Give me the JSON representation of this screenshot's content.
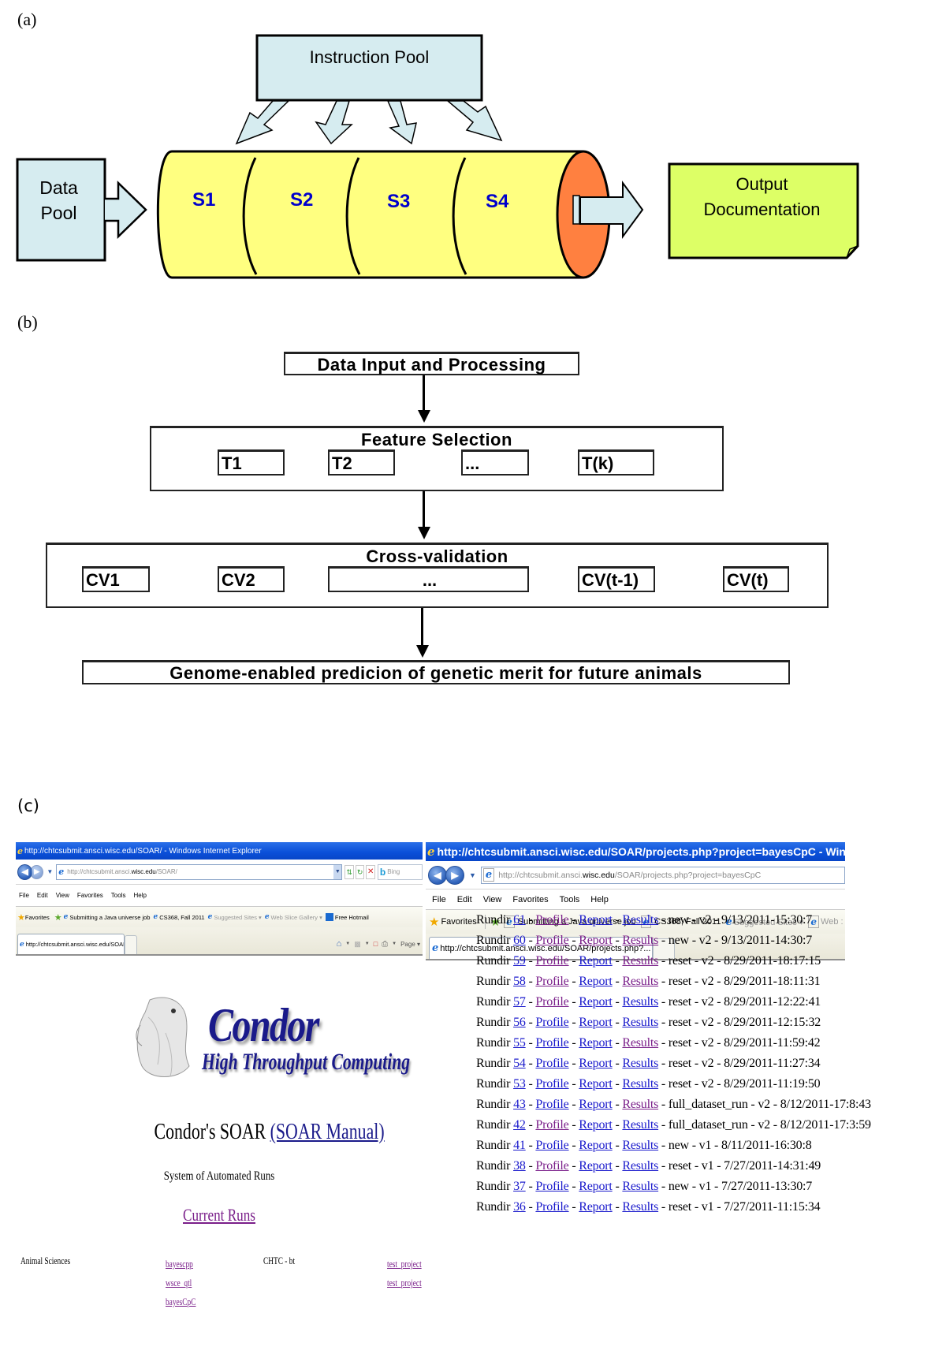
{
  "panel_a": {
    "label": "(a)",
    "instruction_pool": "Instruction Pool",
    "data_pool": [
      "Data",
      "Pool"
    ],
    "stages": [
      "S1",
      "S2",
      "S3",
      "S4"
    ],
    "output": [
      "Output",
      "Documentation"
    ],
    "colors": {
      "pool_fill": "#d6ecf0",
      "cylinder_fill": "#ffff80",
      "cylinder_end": "#ff8040",
      "output_fill": "#ddff66",
      "stage_text": "#0000cc"
    }
  },
  "panel_b": {
    "label": "(b)",
    "step1": "Data Input and Processing",
    "step2_title": "Feature Selection",
    "step2_items": [
      "T1",
      "T2",
      "...",
      "T(k)"
    ],
    "step3_title": "Cross-validation",
    "step3_items": [
      "CV1",
      "CV2",
      "...",
      "CV(t-1)",
      "CV(t)"
    ],
    "step4": "Genome-enabled predicion of genetic merit for future animals"
  },
  "panel_c": {
    "label": "(c)",
    "left_window": {
      "title": "http://chtcsubmit.ansci.wisc.edu/SOAR/ - Windows Internet Explorer",
      "address_prefix": "http://chtcsubmit.ansci.",
      "address_domain": "wisc.edu",
      "address_suffix": "/SOAR/",
      "search_placeholder": "Bing",
      "menu": [
        "File",
        "Edit",
        "View",
        "Favorites",
        "Tools",
        "Help"
      ],
      "favorites_label": "Favorites",
      "favorites": [
        "Submitting a Java universe job",
        "CS368, Fall 2011",
        "Suggested Sites ▾",
        "Web Slice Gallery ▾",
        "Free Hotmail"
      ],
      "tab_title": "http://chtcsubmit.ansci.wisc.edu/SOAR/",
      "page_menu": "Page ▾",
      "logo_word": "Condor",
      "logo_sub": "High Throughput Computing",
      "heading": "Condor's SOAR",
      "heading_link": "(SOAR Manual)",
      "subtitle": "System of Automated Runs",
      "current_runs": "Current Runs",
      "group1": "Animal Sciences",
      "group1_projects": [
        "bayescpp",
        "wsce_qtl",
        "bayesCpC"
      ],
      "group2": "CHTC - bt",
      "group2_projects": [
        "test_project",
        "test_project"
      ]
    },
    "right_window": {
      "title": "http://chtcsubmit.ansci.wisc.edu/SOAR/projects.php?project=bayesCpC - Windows Inte",
      "address_prefix": "http://chtcsubmit.ansci.",
      "address_domain": "wisc.edu",
      "address_suffix": "/SOAR/projects.php?project=bayesCpC",
      "menu": [
        "File",
        "Edit",
        "View",
        "Favorites",
        "Tools",
        "Help"
      ],
      "favorites_label": "Favorites",
      "favorites": [
        "Submitting a Java universe job",
        "CS368, Fall 2011",
        "Suggested Sites ▾",
        "Web :"
      ],
      "tab_title": "http://chtcsubmit.ansci.wisc.edu/SOAR/projects.php?...",
      "runs": [
        {
          "prefix": "Rundir",
          "id": "61",
          "profile": "Profile",
          "report": "Report",
          "results": "Results",
          "status": "new",
          "version": "v2",
          "time": "9/13/2011-15:30:7"
        },
        {
          "prefix": "Rundir",
          "id": "60",
          "profile": "Profile",
          "report": "Report",
          "results": "Results",
          "status": "new",
          "version": "v2",
          "time": "9/13/2011-14:30:7"
        },
        {
          "prefix": "Rundir",
          "id": "59",
          "profile": "Profile",
          "report": "Report",
          "results": "Results",
          "status": "reset",
          "version": "v2",
          "time": "8/29/2011-18:17:15"
        },
        {
          "prefix": "Rundir",
          "id": "58",
          "profile": "Profile",
          "report": "Report",
          "results": "Results",
          "status": "reset",
          "version": "v2",
          "time": "8/29/2011-18:11:31"
        },
        {
          "prefix": "Rundir",
          "id": "57",
          "profile": "Profile",
          "report": "Report",
          "results": "Results",
          "status": "reset",
          "version": "v2",
          "time": "8/29/2011-12:22:41"
        },
        {
          "prefix": "Rundir",
          "id": "56",
          "profile": "Profile",
          "report": "Report",
          "results": "Results",
          "status": "reset",
          "version": "v2",
          "time": "8/29/2011-12:15:32"
        },
        {
          "prefix": "Rundir",
          "id": "55",
          "profile": "Profile",
          "report": "Report",
          "results": "Results",
          "status": "reset",
          "version": "v2",
          "time": "8/29/2011-11:59:42"
        },
        {
          "prefix": "Rundir",
          "id": "54",
          "profile": "Profile",
          "report": "Report",
          "results": "Results",
          "status": "reset",
          "version": "v2",
          "time": "8/29/2011-11:27:34"
        },
        {
          "prefix": "Rundir",
          "id": "53",
          "profile": "Profile",
          "report": "Report",
          "results": "Results",
          "status": "reset",
          "version": "v2",
          "time": "8/29/2011-11:19:50"
        },
        {
          "prefix": "Rundir",
          "id": "43",
          "profile": "Profile",
          "report": "Report",
          "results": "Results",
          "status": "full_dataset_run",
          "version": "v2",
          "time": "8/12/2011-17:8:43"
        },
        {
          "prefix": "Rundir",
          "id": "42",
          "profile": "Profile",
          "report": "Report",
          "results": "Results",
          "status": "full_dataset_run",
          "version": "v2",
          "time": "8/12/2011-17:3:59"
        },
        {
          "prefix": "Rundir",
          "id": "41",
          "profile": "Profile",
          "report": "Report",
          "results": "Results",
          "status": "new",
          "version": "v1",
          "time": "8/11/2011-16:30:8"
        },
        {
          "prefix": "Rundir",
          "id": "38",
          "profile": "Profile",
          "report": "Report",
          "results": "Results",
          "status": "reset",
          "version": "v1",
          "time": "7/27/2011-14:31:49"
        },
        {
          "prefix": "Rundir",
          "id": "37",
          "profile": "Profile",
          "report": "Report",
          "results": "Results",
          "status": "new",
          "version": "v1",
          "time": "7/27/2011-13:30:7"
        },
        {
          "prefix": "Rundir",
          "id": "36",
          "profile": "Profile",
          "report": "Report",
          "results": "Results",
          "status": "reset",
          "version": "v1",
          "time": "7/27/2011-11:15:34"
        }
      ]
    }
  }
}
